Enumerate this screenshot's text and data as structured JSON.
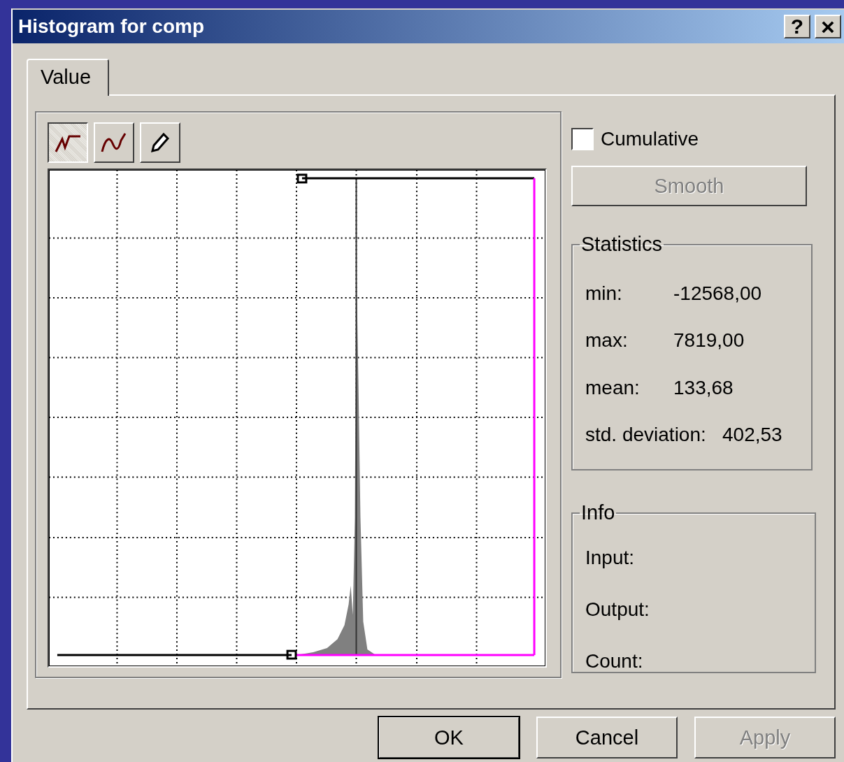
{
  "window": {
    "title": "Histogram for comp",
    "buttons": [
      {
        "kind": "help",
        "label": "?"
      },
      {
        "kind": "close",
        "label": "×"
      }
    ]
  },
  "tabs": [
    {
      "label": "Value",
      "selected": true
    }
  ],
  "tools": [
    {
      "kind": "linear",
      "selected": true
    },
    {
      "kind": "curve",
      "selected": false
    },
    {
      "kind": "pencil",
      "selected": false
    }
  ],
  "cumulative": {
    "label": "Cumulative",
    "checked": false
  },
  "smooth": {
    "label": "Smooth",
    "disabled": true
  },
  "statistics": {
    "title": "Statistics",
    "rows": [
      {
        "label": "min:",
        "value": "-12568,00"
      },
      {
        "label": "max:",
        "value": "7819,00"
      },
      {
        "label": "mean:",
        "value": "133,68"
      },
      {
        "label": "std. deviation:",
        "value": "402,53"
      }
    ]
  },
  "info": {
    "title": "Info",
    "rows": [
      "Input:",
      "Output:",
      "Count:"
    ]
  },
  "buttons": [
    {
      "label": "OK",
      "default": true,
      "disabled": false
    },
    {
      "label": "Cancel",
      "default": false,
      "disabled": false
    },
    {
      "label": "Apply",
      "default": false,
      "disabled": true
    }
  ]
}
